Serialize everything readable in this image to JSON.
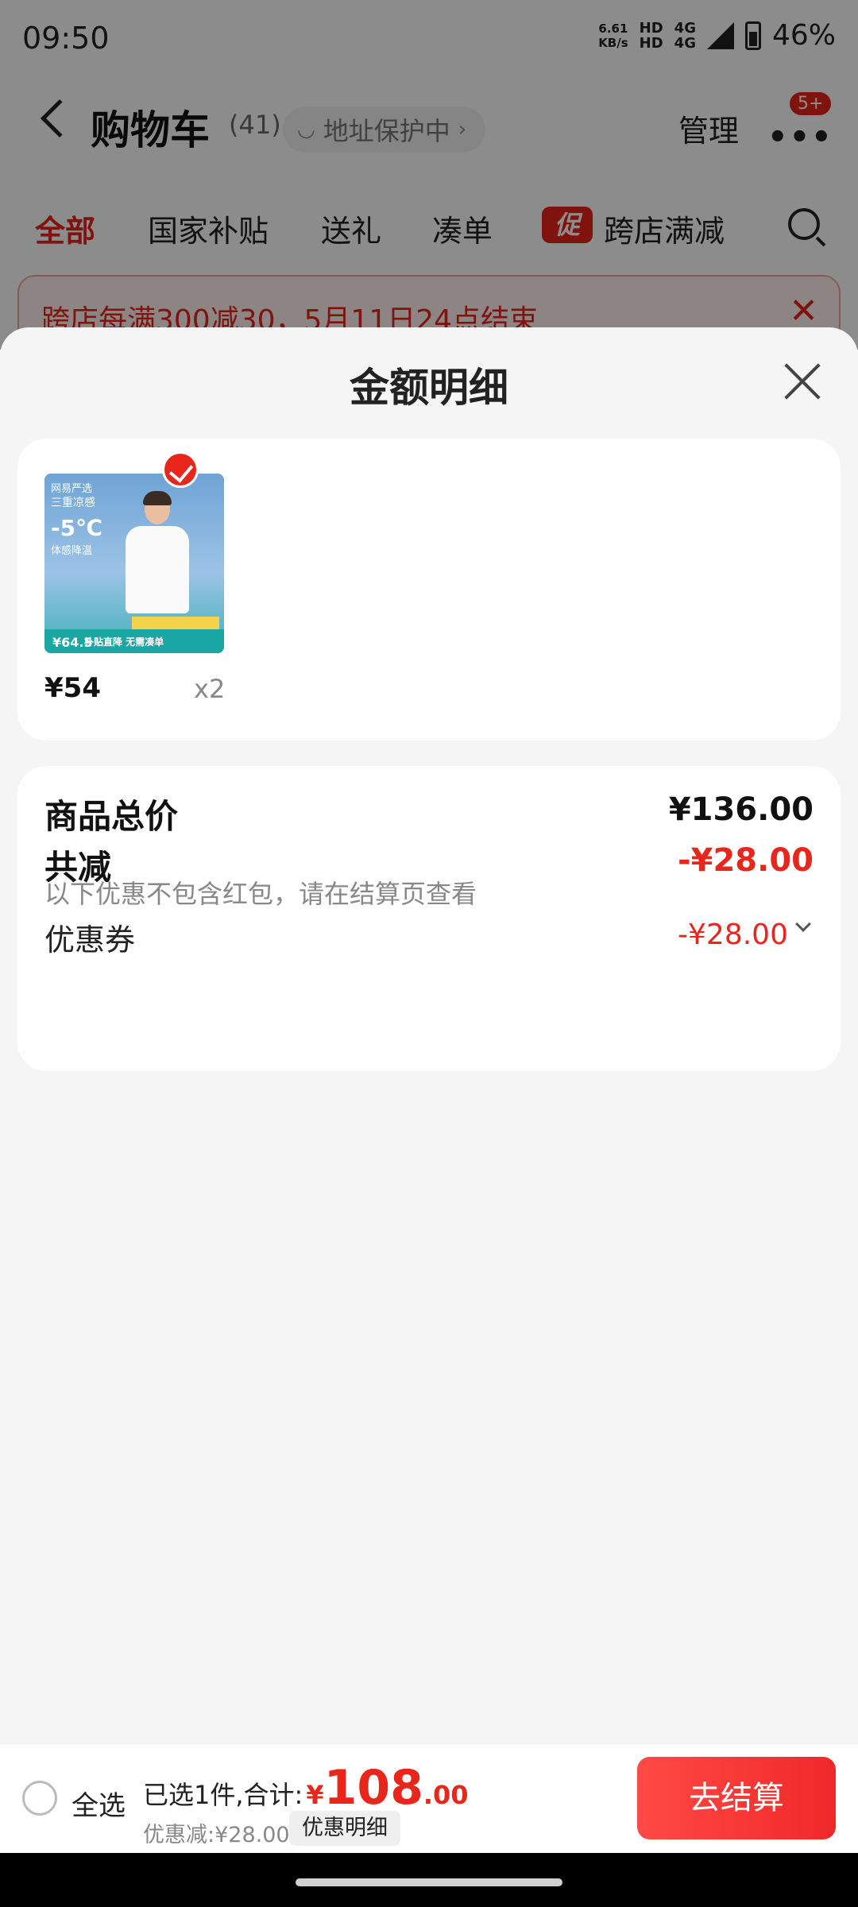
{
  "status_bar": {
    "time": "09:50",
    "net_speed_value": "6.61",
    "net_speed_unit": "KB/s",
    "sim1": "HD",
    "sim2": "HD",
    "network1": "4G",
    "network2": "4G",
    "battery": "46%"
  },
  "header": {
    "title": "购物车",
    "count": "(41)",
    "address_chip": "地址保护中",
    "manage": "管理",
    "more_badge": "5+"
  },
  "tabs": [
    {
      "label": "全部",
      "active": true
    },
    {
      "label": "国家补贴",
      "active": false
    },
    {
      "label": "送礼",
      "active": false
    },
    {
      "label": "凑单",
      "active": false
    },
    {
      "label": "跨店满减",
      "active": false,
      "badge": "促"
    }
  ],
  "promo_banner": {
    "text": "跨店每满300减30，5月11日24点结束"
  },
  "sheet": {
    "title": "金额明细",
    "product": {
      "price": "¥54",
      "quantity": "x2",
      "image": {
        "brand": "网易严选",
        "headline": "三重凉感",
        "temp": "-5℃",
        "sub": "体感降温",
        "strip_text": "补贴直降 无需凑单",
        "price_tag": "¥64.5"
      }
    },
    "summary": {
      "total_label": "商品总价",
      "total_value": "¥136.00",
      "reduce_label": "共减",
      "reduce_value": "-¥28.00",
      "note": "以下优惠不包含红包，请在结算页查看",
      "coupon_label": "优惠券",
      "coupon_value": "-¥28.00"
    }
  },
  "checkout": {
    "select_all": "全选",
    "selected_prefix": "已选1件,合计:",
    "currency": "¥",
    "total_int": "108",
    "total_dec": ".00",
    "discount": "优惠减:¥28.00",
    "detail_chip": "优惠明细",
    "button": "去结算"
  },
  "colors": {
    "accent": "#e8261b",
    "button_gradient_start": "#ff4a44",
    "button_gradient_end": "#f0282a"
  }
}
